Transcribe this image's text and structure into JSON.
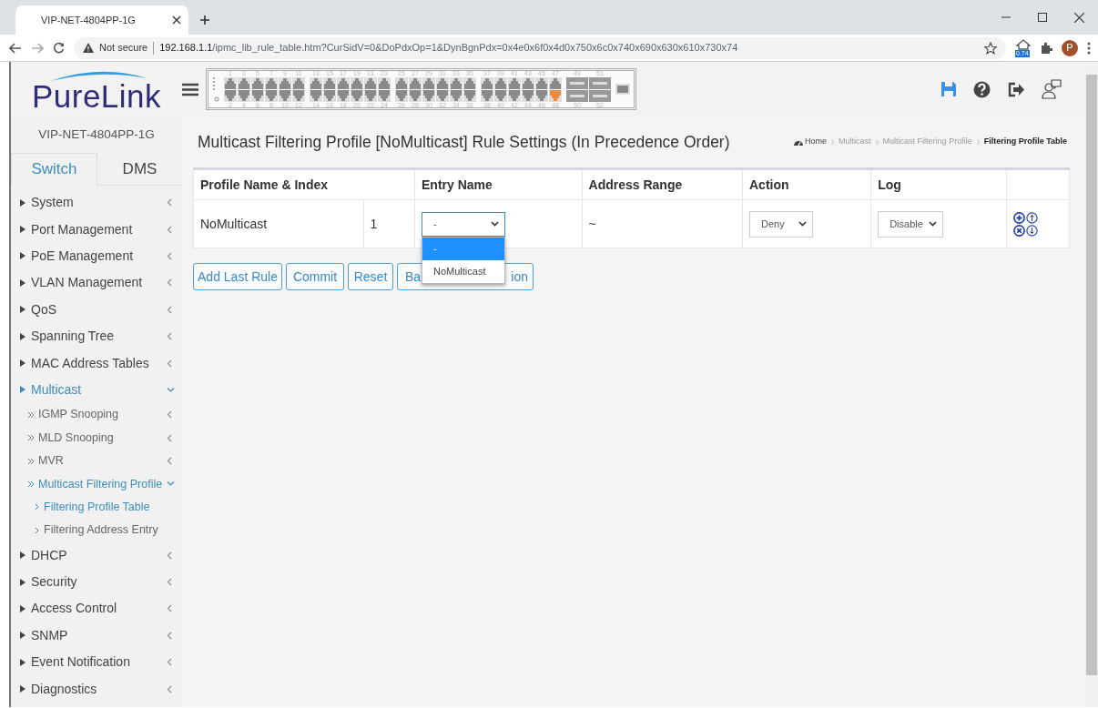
{
  "browser": {
    "tab": {
      "title": "VIP-NET-4804PP-1G"
    },
    "security": "Not secure",
    "url_host": "192.168.1.1",
    "url_path": "/ipmc_lib_rule_table.htm?CurSidV=0&DoPdxOp=1&DynBgnPdx=0x4e0x6f0x4d0x750x6c0x740x690x630x610x730x74",
    "extension_badge": "0.74",
    "profile_initial": "P"
  },
  "header": {
    "logo_start": "Pure",
    "logo_end": "Link",
    "ports": [
      {
        "label": "1",
        "kind": "rj45",
        "linked": false
      },
      {
        "label": "2",
        "kind": "rj45",
        "linked": false
      },
      {
        "label": "3",
        "kind": "rj45",
        "linked": false
      },
      {
        "label": "4",
        "kind": "rj45",
        "linked": false
      },
      {
        "label": "5",
        "kind": "rj45",
        "linked": false
      },
      {
        "label": "6",
        "kind": "rj45",
        "linked": false
      },
      {
        "label": "7",
        "kind": "rj45",
        "linked": false
      },
      {
        "label": "8",
        "kind": "rj45",
        "linked": false
      },
      {
        "label": "9",
        "kind": "rj45",
        "linked": false
      },
      {
        "label": "10",
        "kind": "rj45",
        "linked": false
      },
      {
        "label": "11",
        "kind": "rj45",
        "linked": false
      },
      {
        "label": "12",
        "kind": "rj45",
        "linked": false
      },
      {
        "label": "13",
        "kind": "rj45",
        "linked": false
      },
      {
        "label": "14",
        "kind": "rj45",
        "linked": false
      },
      {
        "label": "15",
        "kind": "rj45",
        "linked": false
      },
      {
        "label": "16",
        "kind": "rj45",
        "linked": false
      },
      {
        "label": "17",
        "kind": "rj45",
        "linked": false
      },
      {
        "label": "18",
        "kind": "rj45",
        "linked": false
      },
      {
        "label": "19",
        "kind": "rj45",
        "linked": false
      },
      {
        "label": "20",
        "kind": "rj45",
        "linked": false
      },
      {
        "label": "21",
        "kind": "rj45",
        "linked": false
      },
      {
        "label": "22",
        "kind": "rj45",
        "linked": false
      },
      {
        "label": "23",
        "kind": "rj45",
        "linked": false
      },
      {
        "label": "24",
        "kind": "rj45",
        "linked": false
      },
      {
        "label": "25",
        "kind": "rj45",
        "linked": false
      },
      {
        "label": "26",
        "kind": "rj45",
        "linked": false
      },
      {
        "label": "27",
        "kind": "rj45",
        "linked": false
      },
      {
        "label": "28",
        "kind": "rj45",
        "linked": false
      },
      {
        "label": "29",
        "kind": "rj45",
        "linked": false
      },
      {
        "label": "30",
        "kind": "rj45",
        "linked": false
      },
      {
        "label": "31",
        "kind": "rj45",
        "linked": false
      },
      {
        "label": "32",
        "kind": "rj45",
        "linked": false
      },
      {
        "label": "33",
        "kind": "rj45",
        "linked": false
      },
      {
        "label": "34",
        "kind": "rj45",
        "linked": false
      },
      {
        "label": "35",
        "kind": "rj45",
        "linked": false
      },
      {
        "label": "36",
        "kind": "rj45",
        "linked": false
      },
      {
        "label": "37",
        "kind": "rj45",
        "linked": false
      },
      {
        "label": "38",
        "kind": "rj45",
        "linked": false
      },
      {
        "label": "39",
        "kind": "rj45",
        "linked": false
      },
      {
        "label": "40",
        "kind": "rj45",
        "linked": false
      },
      {
        "label": "41",
        "kind": "rj45",
        "linked": false
      },
      {
        "label": "42",
        "kind": "rj45",
        "linked": false
      },
      {
        "label": "43",
        "kind": "rj45",
        "linked": false
      },
      {
        "label": "44",
        "kind": "rj45",
        "linked": false
      },
      {
        "label": "45",
        "kind": "rj45",
        "linked": false
      },
      {
        "label": "46",
        "kind": "rj45",
        "linked": false
      },
      {
        "label": "47",
        "kind": "rj45",
        "linked": false
      },
      {
        "label": "48",
        "kind": "rj45",
        "linked": true
      },
      {
        "label": "49",
        "kind": "sfp",
        "linked": false
      },
      {
        "label": "50",
        "kind": "sfp",
        "linked": false
      },
      {
        "label": "51",
        "kind": "sfp",
        "linked": false
      },
      {
        "label": "52",
        "kind": "sfp",
        "linked": false
      }
    ]
  },
  "sidebar": {
    "device": "VIP-NET-4804PP-1G",
    "tabs": [
      {
        "label": "Switch",
        "selected": true
      },
      {
        "label": "DMS",
        "selected": false
      }
    ],
    "items": [
      {
        "label": "System",
        "expanded": false
      },
      {
        "label": "Port Management",
        "expanded": false
      },
      {
        "label": "PoE Management",
        "expanded": false
      },
      {
        "label": "VLAN Management",
        "expanded": false
      },
      {
        "label": "QoS",
        "expanded": false
      },
      {
        "label": "Spanning Tree",
        "expanded": false
      },
      {
        "label": "MAC Address Tables",
        "expanded": false
      },
      {
        "label": "Multicast",
        "expanded": true,
        "children": [
          {
            "label": "IGMP Snooping",
            "expanded": false
          },
          {
            "label": "MLD Snooping",
            "expanded": false
          },
          {
            "label": "MVR",
            "expanded": false
          },
          {
            "label": "Multicast Filtering Profile",
            "expanded": true,
            "children": [
              {
                "label": "Filtering Profile Table",
                "selected": true
              },
              {
                "label": "Filtering Address Entry",
                "selected": false
              }
            ]
          }
        ]
      },
      {
        "label": "DHCP",
        "expanded": false
      },
      {
        "label": "Security",
        "expanded": false
      },
      {
        "label": "Access Control",
        "expanded": false
      },
      {
        "label": "SNMP",
        "expanded": false
      },
      {
        "label": "Event Notification",
        "expanded": false
      },
      {
        "label": "Diagnostics",
        "expanded": false
      }
    ]
  },
  "page": {
    "title": "Multicast Filtering Profile [NoMulticast] Rule Settings (In Precedence Order)",
    "breadcrumb": [
      {
        "label": "Home",
        "kind": "home",
        "current": false
      },
      {
        "label": "Multicast",
        "kind": "link",
        "current": false
      },
      {
        "label": "Multicast Filtering Profile",
        "kind": "link",
        "current": false
      },
      {
        "label": "Filtering Profile Table",
        "kind": "link",
        "current": true
      }
    ],
    "table": {
      "columns": [
        "Profile Name & Index",
        "Entry Name",
        "Address Range",
        "Action",
        "Log"
      ],
      "rows": [
        {
          "profile": "NoMulticast",
          "index": "1",
          "entry": "-",
          "range": "~",
          "action": "Deny",
          "log": "Disable"
        }
      ]
    },
    "dropdown": {
      "options": [
        {
          "label": "-",
          "selected": true
        },
        {
          "label": "NoMulticast",
          "selected": false
        }
      ]
    },
    "buttons": [
      {
        "label": "Add Last Rule",
        "kind": "plain"
      },
      {
        "label": "Commit",
        "kind": "plain"
      },
      {
        "label": "Reset",
        "kind": "plain"
      },
      {
        "label_start": "Ba",
        "label_end": "ion",
        "kind": "covered"
      }
    ]
  }
}
